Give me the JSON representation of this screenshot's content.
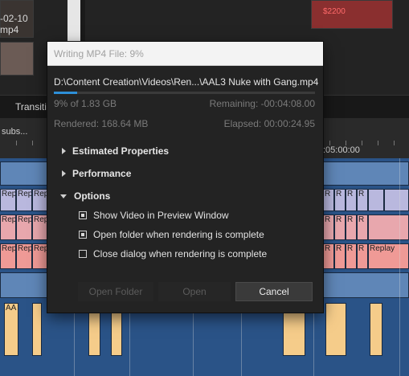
{
  "background": {
    "bin": {
      "clip_name_line1": "-02-10",
      "clip_name_line2": "mp4",
      "thumb_price": "$2200"
    },
    "tabs": {
      "transitions_label": "Transitio"
    },
    "ruler": {
      "subs_label": "subs...",
      "timecode": ":05:00:00"
    },
    "clip_labels": {
      "rep": "Rep",
      "r": "R",
      "replay": "Replay",
      "aa": "AA"
    }
  },
  "dialog": {
    "title": "Writing MP4 File: 9%",
    "output_path": "D:\\Content Creation\\Videos\\Ren...\\AAL3 Nuke with Gang.mp4",
    "progress_fraction": 0.09,
    "progress_text": "9% of 1.83 GB",
    "remaining": "Remaining: -00:04:08.00",
    "rendered": "Rendered: 168.64 MB",
    "elapsed": "Elapsed: 00:00:24.95",
    "sections": {
      "estimated_properties": "Estimated Properties",
      "performance": "Performance",
      "options": "Options"
    },
    "options": {
      "show_video": {
        "label": "Show Video in Preview Window",
        "checked": true
      },
      "open_folder": {
        "label": "Open folder when rendering is complete",
        "checked": true
      },
      "close_dialog": {
        "label": "Close dialog when rendering is complete",
        "checked": false
      }
    },
    "buttons": {
      "open_folder": "Open Folder",
      "open": "Open",
      "cancel": "Cancel"
    },
    "colors": {
      "progress": "#2d8fd8",
      "title_bar": "#f3f3f3",
      "body": "#232323"
    }
  }
}
